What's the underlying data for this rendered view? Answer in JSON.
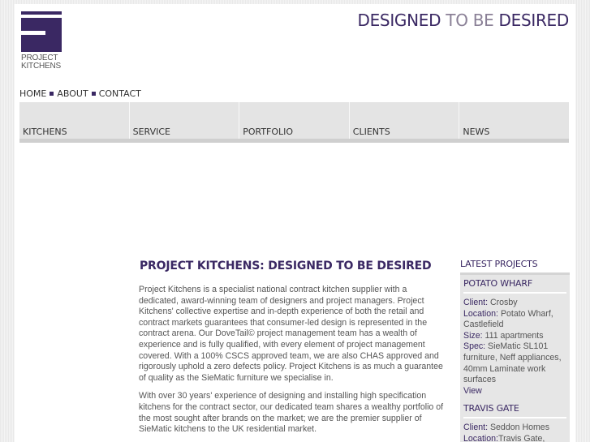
{
  "logo": {
    "line1": "PROJECT",
    "line2": "KITCHENS"
  },
  "tagline": {
    "part1": "DESIGNED",
    "part2": "TO BE",
    "part3": "DESIRED"
  },
  "toplinks": [
    "HOME",
    "ABOUT",
    "CONTACT"
  ],
  "nav": [
    "KITCHENS",
    "SERVICE",
    "PORTFOLIO",
    "CLIENTS",
    "NEWS"
  ],
  "content": {
    "title": "PROJECT KITCHENS: DESIGNED TO BE DESIRED",
    "para1": "Project Kitchens is a specialist national contract kitchen supplier with a dedicated, award-winning team of designers and project managers. Project Kitchens' collective expertise and in-depth experience of both the retail and contract markets guarantees that consumer-led design is represented in the contract arena. Our DoveTail© project management team has a wealth of experience and is fully qualified, with every element of project management covered. With a 100% CSCS approved team, we are also CHAS approved and rigorously uphold a zero defects policy. Project Kitchens is as much a guarantee of quality as the SieMatic furniture we specialise in.",
    "para2": "With over 30 years' experience of designing and installing high specification kitchens for the contract sector, our dedicated team shares a wealthy portfolio of the most sought after brands on the market; we are the premier supplier of SieMatic kitchens to the UK residential market."
  },
  "sidebar": {
    "heading": "LATEST PROJECTS",
    "projects": [
      {
        "title": "POTATO WHARF",
        "client_label": "Client:",
        "client": " Crosby",
        "location_label": "Location:",
        "location": " Potato Wharf, Castlefield",
        "size_label": "Size:",
        "size": " 111 apartments",
        "spec_label": "Spec:",
        "spec": " SieMatic SL101 furniture, Neff appliances, 40mm Laminate work surfaces",
        "view": "View"
      },
      {
        "title": "TRAVIS GATE",
        "client_label": "Client:",
        "client": " Seddon Homes",
        "location_label": "Location:",
        "location": "Travis Gate, Chorlton Green"
      }
    ]
  }
}
